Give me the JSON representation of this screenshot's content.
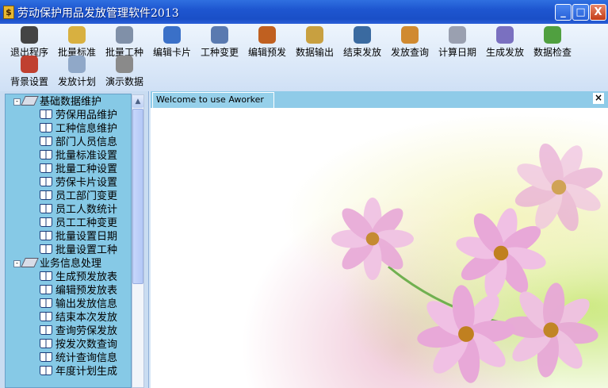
{
  "window": {
    "title": "劳动保护用品发放管理软件2013",
    "minimize": "_",
    "maximize": "□",
    "close": "X"
  },
  "toolbar": [
    {
      "label": "退出程序",
      "icon": "exit-door-icon",
      "color": "#444444"
    },
    {
      "label": "批量标准",
      "icon": "folder-arrow-icon",
      "color": "#d8b040"
    },
    {
      "label": "批量工种",
      "icon": "document-pen-icon",
      "color": "#8090a8"
    },
    {
      "label": "编辑卡片",
      "icon": "window-chart-icon",
      "color": "#3a70c8"
    },
    {
      "label": "工种变更",
      "icon": "swap-arrow-icon",
      "color": "#5a7ab0"
    },
    {
      "label": "编辑预发",
      "icon": "users-icon",
      "color": "#c06020"
    },
    {
      "label": "数据输出",
      "icon": "clipboard-icon",
      "color": "#c8a040"
    },
    {
      "label": "结束发放",
      "icon": "jar-icon",
      "color": "#3a6aa0"
    },
    {
      "label": "发放查询",
      "icon": "magnifier-icon",
      "color": "#d08a30"
    },
    {
      "label": "计算日期",
      "icon": "document-icon",
      "color": "#9aa0b0"
    },
    {
      "label": "生成发放",
      "icon": "play-icon",
      "color": "#7a70c0"
    },
    {
      "label": "数据检查",
      "icon": "group-icon",
      "color": "#50a040"
    },
    {
      "label": "背景设置",
      "icon": "wrench-icon",
      "color": "#c04030"
    },
    {
      "label": "发放计划",
      "icon": "envelope-icon",
      "color": "#90a8c8"
    },
    {
      "label": "演示数据",
      "icon": "database-icon",
      "color": "#8a8a8a"
    }
  ],
  "tree": [
    {
      "label": "基础数据维护",
      "children": [
        "劳保用品维护",
        "工种信息维护",
        "部门人员信息",
        "批量标准设置",
        "批量工种设置",
        "劳保卡片设置",
        "员工部门变更",
        "员工人数统计",
        "员工工种变更",
        "批量设置日期",
        "批量设置工种"
      ]
    },
    {
      "label": "业务信息处理",
      "children": [
        "生成预发放表",
        "编辑预发放表",
        "输出发放信息",
        "结束本次发放",
        "查询劳保发放",
        "按发次数查询",
        "统计查询信息",
        "年度计划生成"
      ]
    }
  ],
  "tabs": [
    {
      "label": "Welcome  to use  Aworker"
    }
  ],
  "tab_close": "×"
}
